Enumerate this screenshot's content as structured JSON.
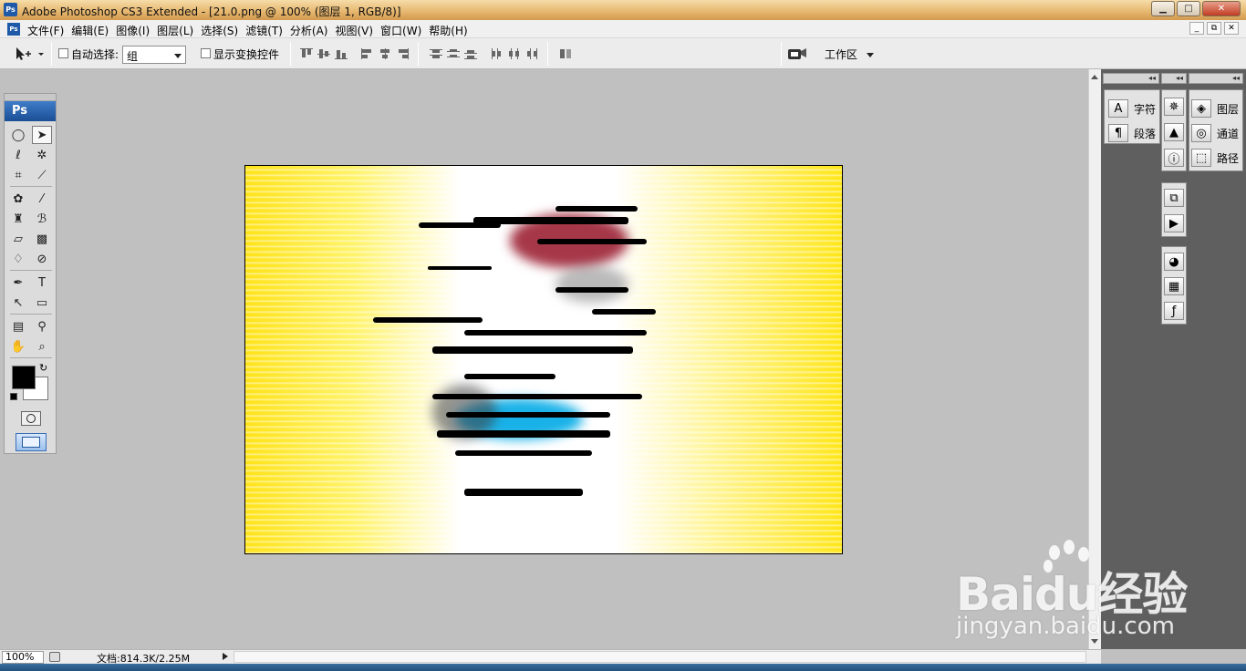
{
  "window": {
    "app_icon": "Ps",
    "title": "Adobe Photoshop CS3 Extended - [21.0.png @ 100% (图层 1, RGB/8)]",
    "controls": {
      "minimize": "▁",
      "maximize": "□",
      "close": "✕"
    }
  },
  "menubar": {
    "items": [
      "文件(F)",
      "编辑(E)",
      "图像(I)",
      "图层(L)",
      "选择(S)",
      "滤镜(T)",
      "分析(A)",
      "视图(V)",
      "窗口(W)",
      "帮助(H)"
    ],
    "doc_controls": {
      "minimize": "_",
      "restore": "⧉",
      "close": "✕"
    }
  },
  "options_bar": {
    "auto_select_label": "自动选择:",
    "auto_select_value": "组",
    "show_transform_label": "显示变换控件",
    "workspace_label": "工作区"
  },
  "toolbox": {
    "header": "Ps",
    "foreground_color": "#000000",
    "background_color": "#ffffff"
  },
  "document": {
    "zoom": "100%",
    "doc_info": "文档:814.3K/2.25M"
  },
  "panels": {
    "group1": [
      "字符",
      "段落"
    ],
    "group3": [
      "图层",
      "通道",
      "路径"
    ]
  },
  "watermark": {
    "brand_latin": "Bai",
    "brand_du": "du",
    "brand_cn": "经验",
    "url": "jingyan.baidu.com"
  }
}
